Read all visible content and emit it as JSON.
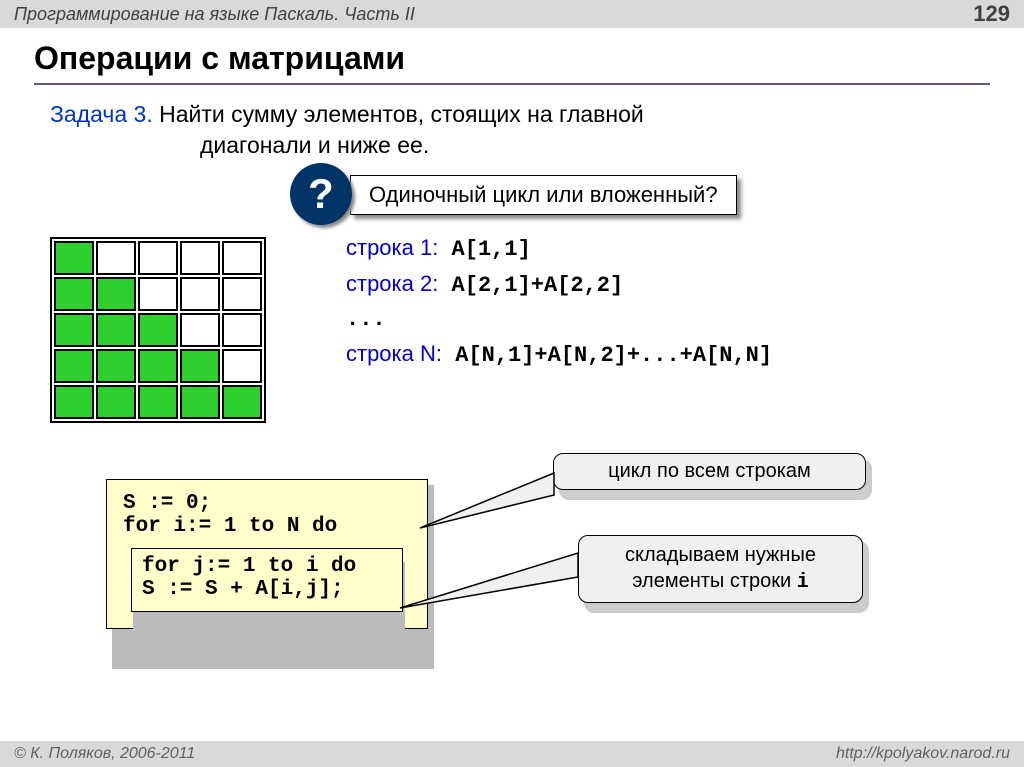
{
  "header": {
    "title": "Программирование на языке Паскаль. Часть II",
    "page": "129"
  },
  "title": "Операции с матрицами",
  "task": {
    "label": "Задача 3.",
    "line1": " Найти сумму элементов, стоящих  на главной",
    "line2": "диагонали и ниже ее."
  },
  "question": {
    "mark": "?",
    "text": "Одиночный цикл или вложенный?"
  },
  "matrix": [
    [
      1,
      0,
      0,
      0,
      0
    ],
    [
      1,
      1,
      0,
      0,
      0
    ],
    [
      1,
      1,
      1,
      0,
      0
    ],
    [
      1,
      1,
      1,
      1,
      0
    ],
    [
      1,
      1,
      1,
      1,
      1
    ]
  ],
  "rows": {
    "r1_label": "строка 1:",
    "r1_code": " A[1,1]",
    "r2_label": "строка 2:",
    "r2_code": " A[2,1]+A[2,2]",
    "dots": "...",
    "rN_label": "строка N:",
    "rN_code": " A[N,1]+A[N,2]+...+A[N,N]"
  },
  "code": {
    "l1": "S := 0;",
    "l2": "for i:= 1 to N do",
    "l3": "for j:= 1 to i do",
    "l4": "  S := S + A[i,j];"
  },
  "callouts": {
    "c1": "цикл по всем строкам",
    "c2a": "складываем нужные",
    "c2b": "элементы строки ",
    "c2c": "i"
  },
  "footer": {
    "left": "© К. Поляков, 2006-2011",
    "right": "http://kpolyakov.narod.ru"
  }
}
